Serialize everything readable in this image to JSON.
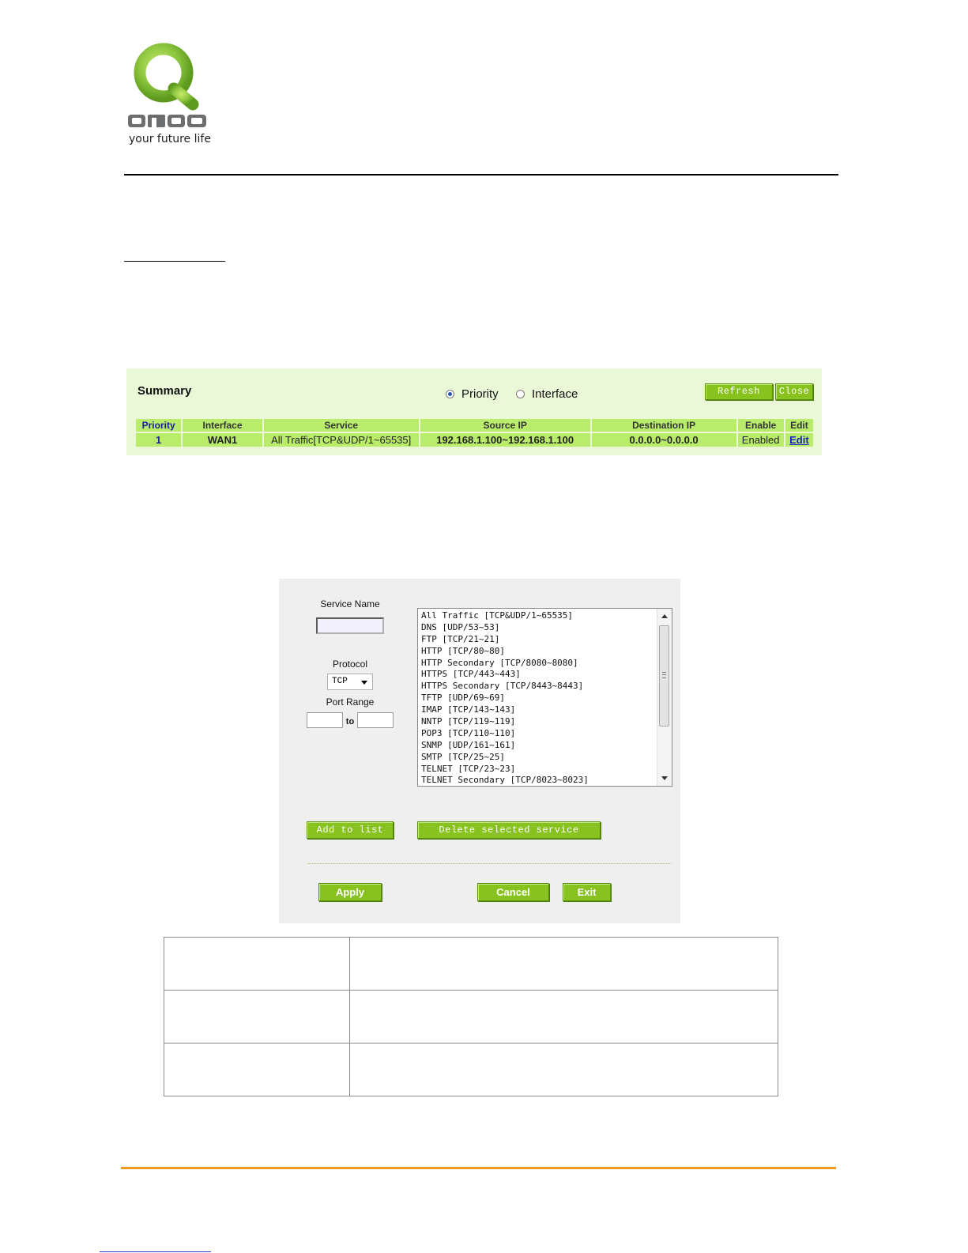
{
  "logo": {
    "tagline": "your future life",
    "brand": "QNO",
    "icon": "qno-logo",
    "colors": {
      "green": "#8cc63f",
      "gray": "#6d6e70"
    }
  },
  "summary": {
    "title": "Summary",
    "view_options": [
      {
        "label": "Priority",
        "selected": true
      },
      {
        "label": "Interface",
        "selected": false
      }
    ],
    "buttons": {
      "refresh": "Refresh",
      "close": "Close"
    },
    "columns": [
      "Priority",
      "Interface",
      "Service",
      "Source IP",
      "Destination IP",
      "Enable",
      "Edit"
    ],
    "rows": [
      {
        "priority": "1",
        "interface": "WAN1",
        "service": "All Traffic[TCP&UDP/1~65535]",
        "source_ip": "192.168.1.100~192.168.1.100",
        "destination_ip": "0.0.0.0~0.0.0.0",
        "enable": "Enabled",
        "edit": "Edit"
      }
    ]
  },
  "service_dialog": {
    "service_name_label": "Service Name",
    "service_name_value": "",
    "protocol_label": "Protocol",
    "protocol_value": "TCP",
    "port_range_label": "Port Range",
    "port_range_to": "to",
    "port_from_value": "",
    "port_to_value": "",
    "services": [
      "All Traffic [TCP&UDP/1~65535]",
      "DNS [UDP/53~53]",
      "FTP [TCP/21~21]",
      "HTTP [TCP/80~80]",
      "HTTP Secondary [TCP/8080~8080]",
      "HTTPS [TCP/443~443]",
      "HTTPS Secondary [TCP/8443~8443]",
      "TFTP [UDP/69~69]",
      "IMAP [TCP/143~143]",
      "NNTP [TCP/119~119]",
      "POP3 [TCP/110~110]",
      "SNMP [UDP/161~161]",
      "SMTP [TCP/25~25]",
      "TELNET [TCP/23~23]",
      "TELNET Secondary [TCP/8023~8023]"
    ],
    "buttons": {
      "add": "Add to list",
      "delete": "Delete selected service",
      "apply": "Apply",
      "cancel": "Cancel",
      "exit": "Exit"
    },
    "accent_color": "#88c21e"
  },
  "colors": {
    "footer_rule": "#f29a1a",
    "table_header": "#b8ec6a",
    "panel_bg": "#eaf8d8"
  }
}
